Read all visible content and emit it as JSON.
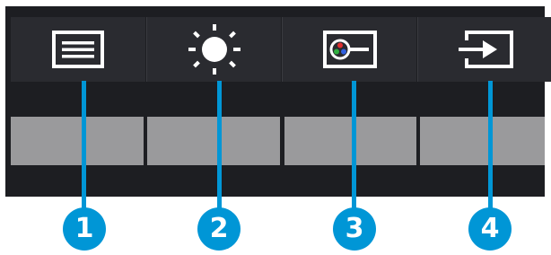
{
  "osd": {
    "buttons": [
      {
        "icon": "menu-icon",
        "callout": "1"
      },
      {
        "icon": "brightness-icon",
        "callout": "2"
      },
      {
        "icon": "color-icon",
        "callout": "3"
      },
      {
        "icon": "input-icon",
        "callout": "4"
      }
    ]
  },
  "colors": {
    "panel": "#1d1e22",
    "tile": "#2a2b30",
    "slot": "#9a9a9c",
    "callout": "#0096d6",
    "icon": "#ffffff"
  }
}
